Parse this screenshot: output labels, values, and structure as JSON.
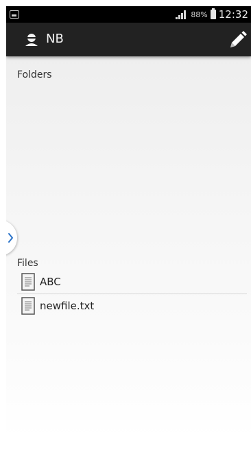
{
  "status_bar": {
    "battery_percent": "88%",
    "time": "12:32",
    "icons": [
      "screenshot-notification-icon",
      "signal-icon",
      "battery-icon"
    ]
  },
  "action_bar": {
    "account_name": "NB",
    "icons": [
      "account-icon",
      "pencil-icon"
    ]
  },
  "folders": {
    "label": "Folders",
    "items": []
  },
  "files": {
    "label": "Files",
    "items": [
      {
        "name": "ABC",
        "icon": "document-icon"
      },
      {
        "name": "newfile.txt",
        "icon": "document-icon"
      }
    ]
  },
  "drawer_handle": {
    "icon": "chevron-right-icon"
  },
  "colors": {
    "action_bar": "#222222",
    "status_bar": "#000000",
    "accent": "#2a73c9"
  }
}
